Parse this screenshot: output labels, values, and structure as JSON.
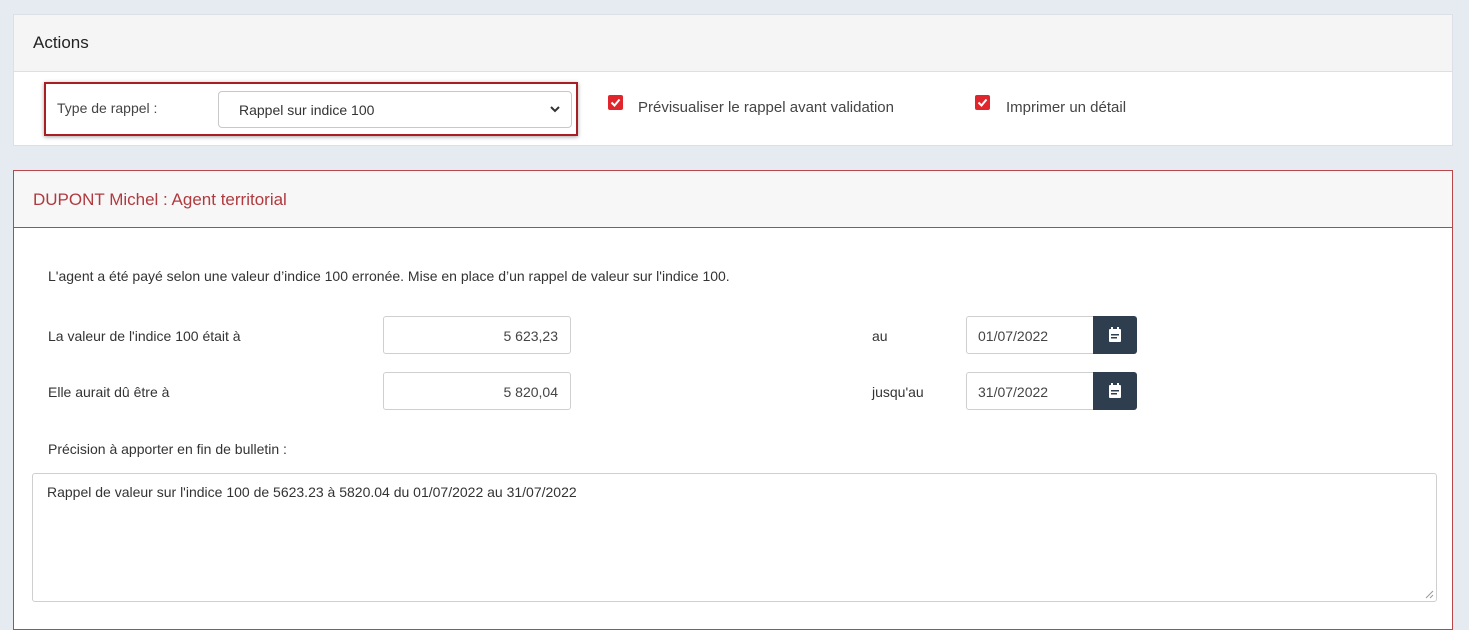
{
  "actions": {
    "title": "Actions",
    "type_label": "Type de rappel :",
    "type_select_value": "Rappel sur indice 100",
    "preview_label": "Prévisualiser le rappel avant validation",
    "preview_checked": true,
    "print_label": "Imprimer un détail",
    "print_checked": true
  },
  "agent": {
    "title": "DUPONT Michel : Agent territorial",
    "description": "L'agent a été payé selon une valeur d’indice 100 erronée. Mise en place d’un rappel de valeur sur l'indice 100.",
    "row1": {
      "label": "La valeur de l'indice 100 était à",
      "value": "5 623,23",
      "date_label": "au",
      "date": "01/07/2022"
    },
    "row2": {
      "label": "Elle aurait dû être à",
      "value": "5 820,04",
      "date_label": "jusqu'au",
      "date": "31/07/2022"
    },
    "precision_label": "Précision à apporter en fin de bulletin :",
    "precision_text": "Rappel de valeur sur l'indice 100 de 5623.23 à 5820.04 du 01/07/2022 au 31/07/2022"
  },
  "colors": {
    "accent_red": "#e0262c",
    "panel_border_red": "#b8464a",
    "calendar_button": "#2e3e4e"
  },
  "icons": {
    "select_chevron": "chevron-down-icon",
    "checkbox": "check-icon",
    "calendar": "calendar-icon"
  }
}
